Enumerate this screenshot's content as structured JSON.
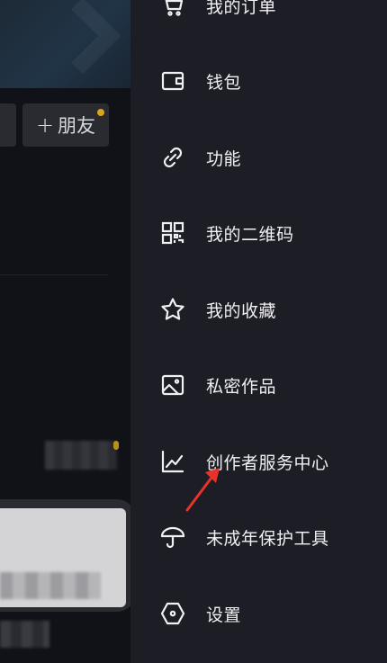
{
  "background": {
    "friends_button_label": "朋友",
    "friends_plus": "+"
  },
  "drawer": {
    "items": [
      {
        "label": "我的订单",
        "icon": "cart-icon"
      },
      {
        "label": "钱包",
        "icon": "wallet-icon"
      },
      {
        "label": "功能",
        "icon": "link-icon"
      },
      {
        "label": "我的二维码",
        "icon": "qrcode-icon"
      },
      {
        "label": "我的收藏",
        "icon": "star-icon"
      },
      {
        "label": "私密作品",
        "icon": "image-icon"
      },
      {
        "label": "创作者服务中心",
        "icon": "chart-icon"
      },
      {
        "label": "未成年保护工具",
        "icon": "umbrella-icon"
      },
      {
        "label": "设置",
        "icon": "hexagon-icon"
      }
    ]
  },
  "colors": {
    "drawer_bg": "#1c1d25",
    "annotation_arrow": "#e8322a",
    "notification_dot": "#d9a51b"
  }
}
